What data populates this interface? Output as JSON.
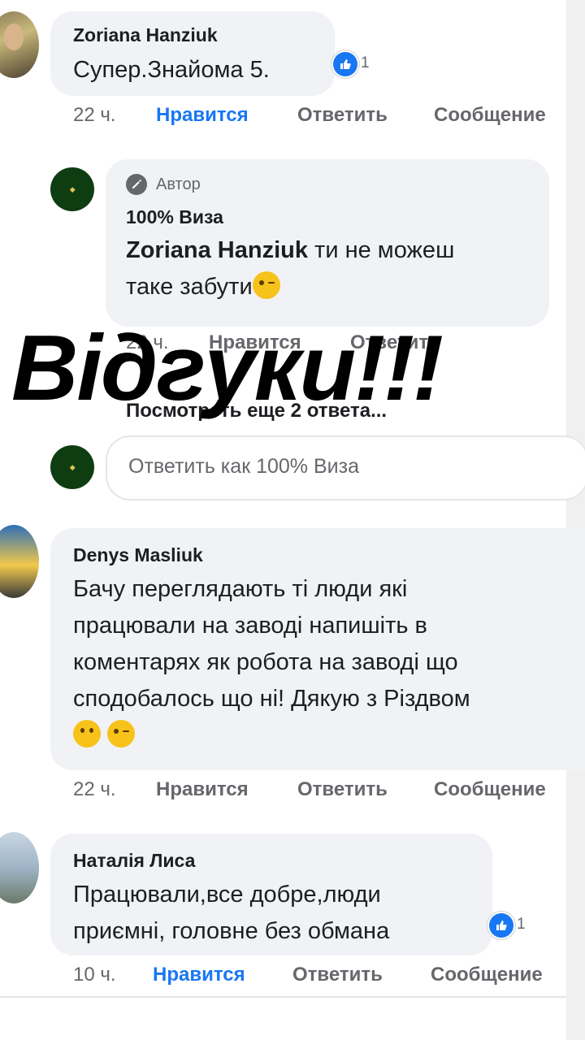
{
  "overlay_title": "Відгуки!!!",
  "comments": [
    {
      "author": "Zoriana Hanziuk",
      "text": "Супер.Знайома 5.",
      "reactions": "1",
      "time": "22 ч.",
      "like": "Нравится",
      "reply": "Ответить",
      "message": "Сообщение"
    },
    {
      "author_badge": "Автор",
      "author": "100% Виза",
      "mention": "Zoriana Hanziuk",
      "text_line1": " ти не можеш",
      "text_line2": "таке забути",
      "time": "22 ч.",
      "like": "Нравится",
      "reply": "Ответить"
    },
    {
      "author": "Denys Masliuk",
      "lines": [
        "Бачу переглядають ті люди які",
        "працювали на заводі напишіть в",
        "коментарях як робота на заводі що",
        "сподобалось що ні! Дякую з Різдвом"
      ],
      "time": "22 ч.",
      "like": "Нравится",
      "reply": "Ответить",
      "message": "Сообщение"
    },
    {
      "author": "Наталія Лиса",
      "lines": [
        "Працювали,все добре,люди",
        "приємні, головне без обмана"
      ],
      "reactions": "1",
      "time": "10 ч.",
      "like": "Нравится",
      "reply": "Ответить",
      "message": "Сообщение"
    }
  ],
  "more_replies": "Посмотреть еще 2 ответа...",
  "reply_box": {
    "placeholder": "Ответить как 100% Виза"
  },
  "icons": {
    "like": "thumbs-up-icon",
    "author": "pencil-icon",
    "emoji_wink": "winking-face-icon",
    "emoji_think": "thinking-face-icon"
  },
  "colors": {
    "like_blue": "#1877f2",
    "bubble": "#f0f2f5",
    "meta_gray": "#65676b"
  }
}
